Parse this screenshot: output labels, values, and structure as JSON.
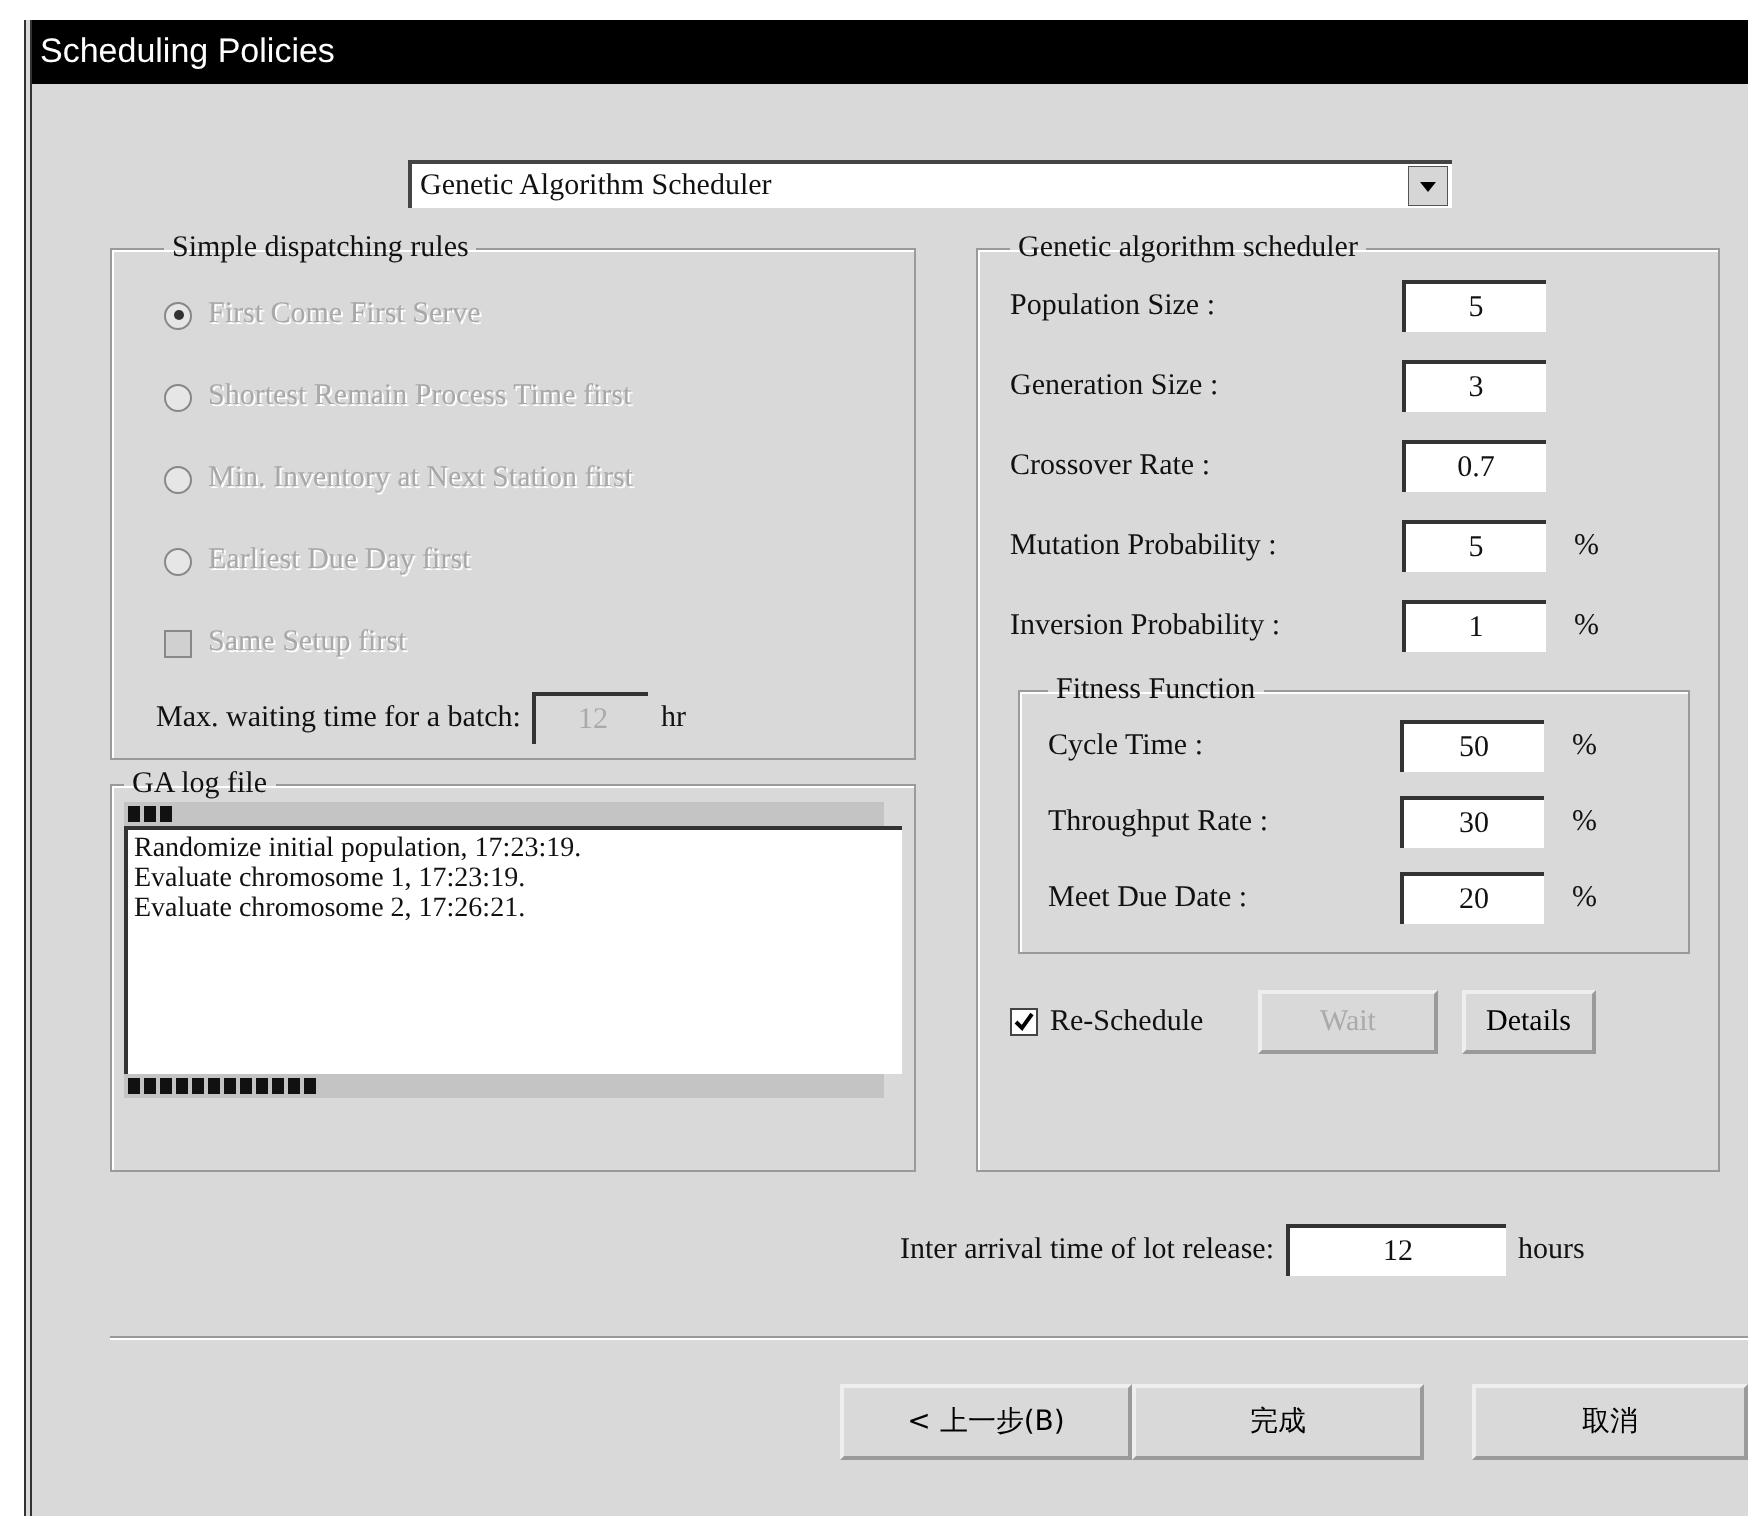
{
  "window": {
    "title": "Scheduling Policies"
  },
  "scheduler_select": {
    "value": "Genetic Algorithm Scheduler"
  },
  "dispatching": {
    "title": "Simple dispatching rules",
    "disabled": true,
    "rules": [
      {
        "label": "First Come First Serve",
        "selected": true
      },
      {
        "label": "Shortest Remain Process Time first",
        "selected": false
      },
      {
        "label": "Min. Inventory at Next Station first",
        "selected": false
      },
      {
        "label": "Earliest Due Day first",
        "selected": false
      }
    ],
    "same_setup": {
      "label": "Same Setup first",
      "checked": false
    },
    "max_wait": {
      "label": "Max. waiting time for a batch:",
      "value": "12",
      "unit": "hr"
    }
  },
  "log": {
    "title": "GA log file",
    "lines": [
      "Randomize initial population, 17:23:19.",
      "Evaluate chromosome 1, 17:23:19.",
      "Evaluate chromosome 2, 17:26:21."
    ]
  },
  "ga": {
    "title": "Genetic algorithm scheduler",
    "params": [
      {
        "label": "Population Size :",
        "value": "5"
      },
      {
        "label": "Generation Size :",
        "value": "3"
      },
      {
        "label": "Crossover Rate :",
        "value": "0.7"
      },
      {
        "label": "Mutation Probability :",
        "value": "5",
        "unit": "%"
      },
      {
        "label": "Inversion Probability :",
        "value": "1",
        "unit": "%"
      }
    ],
    "fitness": {
      "title": "Fitness Function",
      "items": [
        {
          "label": "Cycle Time :",
          "value": "50",
          "unit": "%"
        },
        {
          "label": "Throughput Rate :",
          "value": "30",
          "unit": "%"
        },
        {
          "label": "Meet Due Date :",
          "value": "20",
          "unit": "%"
        }
      ]
    },
    "reschedule": {
      "label": "Re-Schedule",
      "checked": true
    },
    "buttons": [
      {
        "label": "Wait",
        "disabled": true
      },
      {
        "label": "Details",
        "disabled": false
      }
    ]
  },
  "inter_arrival": {
    "label": "Inter arrival time of lot release:",
    "value": "12",
    "unit": "hours"
  },
  "footer_buttons": [
    {
      "label": "< 上一步(B)"
    },
    {
      "label": "完成"
    },
    {
      "label": "取消"
    }
  ]
}
